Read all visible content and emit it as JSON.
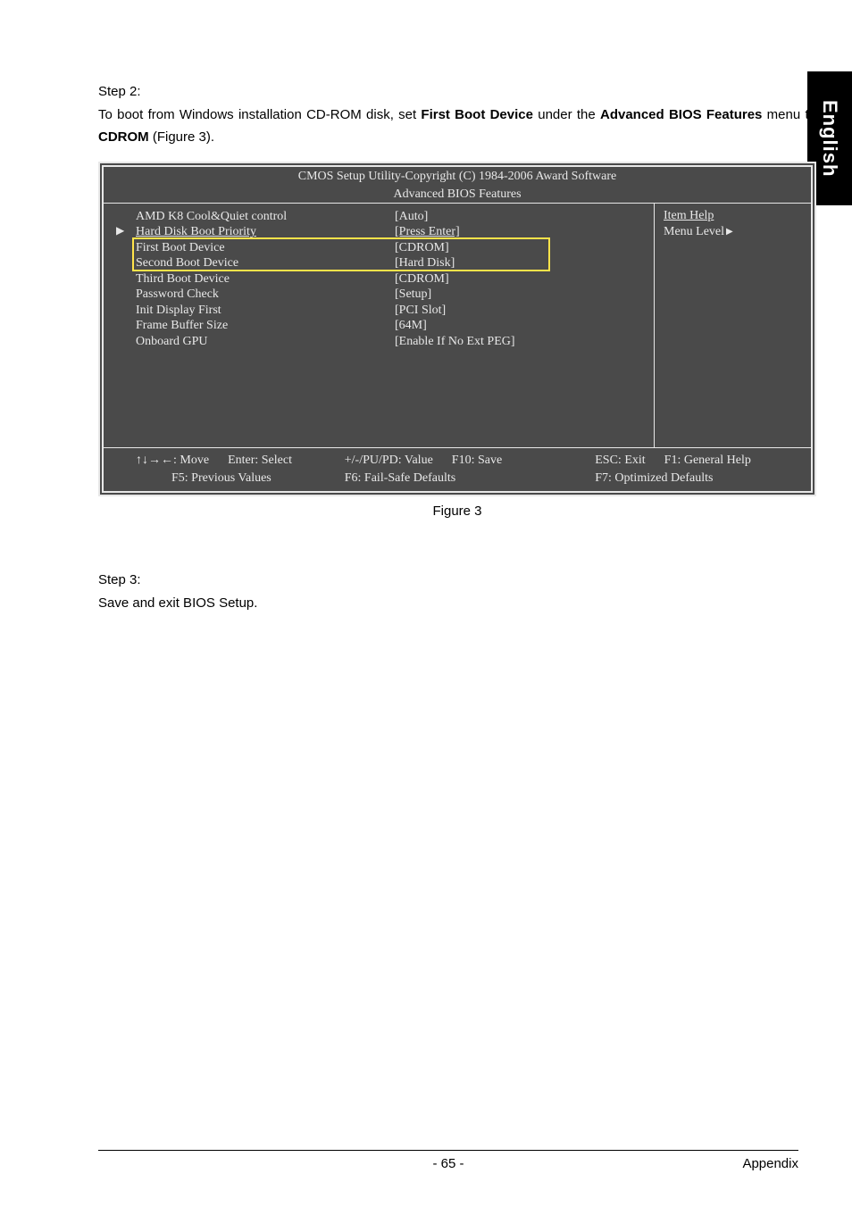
{
  "side_tab": "English",
  "step2": {
    "heading": "Step 2:",
    "line_pre": "To boot from Windows installation CD-ROM disk, set ",
    "bold1": "First Boot Device",
    "mid1": " under the ",
    "bold2": "Advanced BIOS Features",
    "mid2": " menu to ",
    "bold3": "CDROM",
    "tail": "  (Figure 3)."
  },
  "bios": {
    "title1": "CMOS Setup Utility-Copyright (C) 1984-2006 Award Software",
    "title2": "Advanced BIOS Features",
    "rows": [
      {
        "label": "AMD K8 Cool&Quiet control",
        "value": "[Auto]",
        "ul": false
      },
      {
        "label": "Hard Disk Boot Priority",
        "value": "[Press Enter]",
        "ul": true,
        "arrow": true
      },
      {
        "label": "First Boot Device",
        "value": "[CDROM]",
        "ul": false
      },
      {
        "label": "Second Boot Device",
        "value": "[Hard Disk]",
        "ul": false
      },
      {
        "label": "Third Boot Device",
        "value": "[CDROM]",
        "ul": false
      },
      {
        "label": "Password Check",
        "value": "[Setup]",
        "ul": false
      },
      {
        "label": "Init Display First",
        "value": "[PCI Slot]",
        "ul": false
      },
      {
        "label": "Frame Buffer Size",
        "value": "[64M]",
        "ul": false
      },
      {
        "label": "Onboard GPU",
        "value": "[Enable If No Ext PEG]",
        "ul": false
      }
    ],
    "right": {
      "title": "Item Help",
      "level": "Menu Level"
    },
    "footer": {
      "c1a": "↑↓→←: Move",
      "c1b": "Enter: Select",
      "c2a": "+/-/PU/PD: Value",
      "c2b": "F10: Save",
      "c3a": "ESC: Exit",
      "c3b": "F1: General Help",
      "r2a": "F5: Previous Values",
      "r2b": "F6: Fail-Safe Defaults",
      "r2c": "F7: Optimized Defaults"
    }
  },
  "figure_caption": "Figure 3",
  "step3": {
    "heading": "Step 3:",
    "line": "Save and exit BIOS Setup."
  },
  "footer": {
    "page": "- 65 -",
    "section": "Appendix"
  }
}
